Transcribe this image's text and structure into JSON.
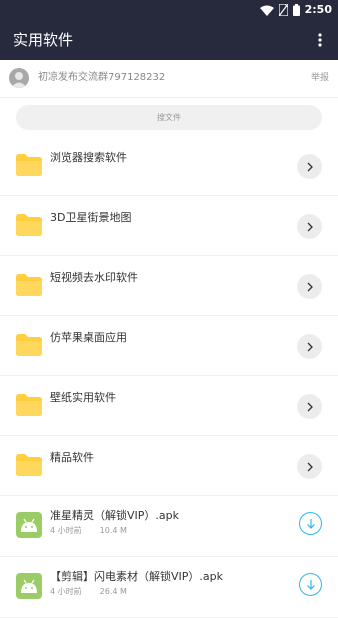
{
  "status_bar": {
    "time": "2:50"
  },
  "app_bar": {
    "title": "实用软件"
  },
  "profile": {
    "text": "初凉发布交流群797128232",
    "report_label": "举报"
  },
  "search": {
    "placeholder": "搜文件"
  },
  "folders": [
    {
      "name": "浏览器搜索软件"
    },
    {
      "name": "3D卫星街景地图"
    },
    {
      "name": "短视频去水印软件"
    },
    {
      "name": "仿苹果桌面应用"
    },
    {
      "name": "壁纸实用软件"
    },
    {
      "name": "精品软件"
    }
  ],
  "files": [
    {
      "name": "准星精灵（解锁VIP）.apk",
      "time": "4 小时前",
      "size": "10.4 M"
    },
    {
      "name": "【剪辑】闪电素材（解锁VIP）.apk",
      "time": "4 小时前",
      "size": "26.4 M"
    }
  ],
  "colors": {
    "bar": "#272a3d",
    "folder": "#ffcf40",
    "apk": "#9ccc65",
    "download": "#29b6f6"
  }
}
